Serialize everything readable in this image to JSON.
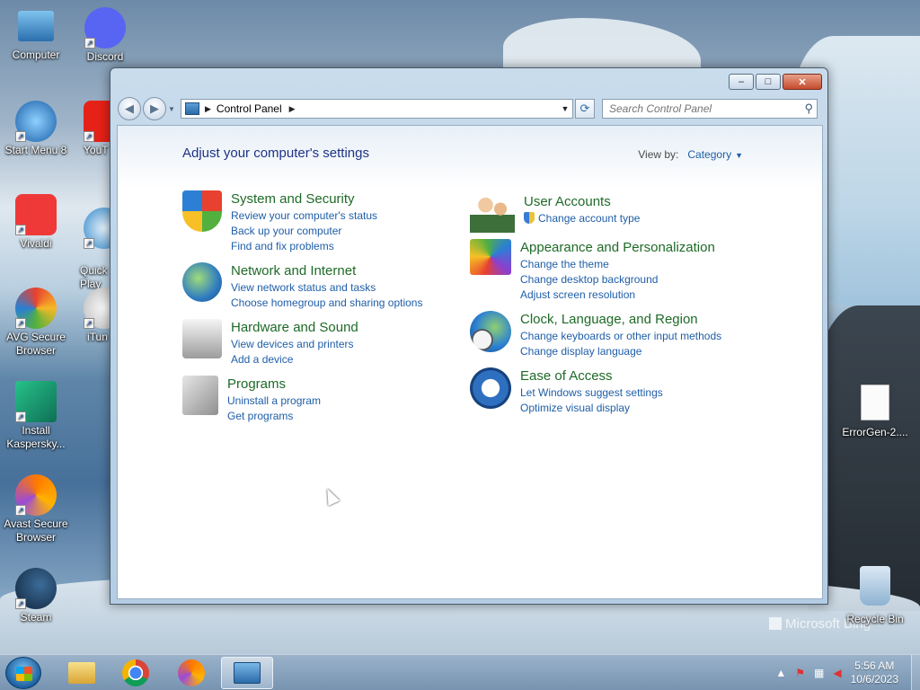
{
  "desktop": {
    "icons": [
      {
        "label": "Computer"
      },
      {
        "label": "Discord"
      },
      {
        "label": "Start Menu 8"
      },
      {
        "label": "YouT"
      },
      {
        "label": "Vivaldi"
      },
      {
        "label": "Quick\nPlay"
      },
      {
        "label": "AVG Secure Browser"
      },
      {
        "label": "iTun"
      },
      {
        "label": "Install Kaspersky..."
      },
      {
        "label": "Avast Secure Browser"
      },
      {
        "label": "Steam"
      },
      {
        "label": "ErrorGen-2...."
      },
      {
        "label": "Recycle Bin"
      }
    ],
    "watermark": "Microsoft Bing"
  },
  "window": {
    "title_buttons": {
      "minimize": "–",
      "maximize": "□",
      "close": "✕"
    },
    "nav": {
      "back": "◀",
      "forward": "▶",
      "dropdown": "▼"
    },
    "address": {
      "crumbs": [
        "Control Panel"
      ],
      "separator": "▶",
      "dropdown": "▼"
    },
    "refresh": "⟳",
    "search": {
      "placeholder": "Search Control Panel",
      "icon": "search-icon"
    },
    "heading": "Adjust your computer's settings",
    "view_by": {
      "label": "View by:",
      "value": "Category"
    },
    "categories_left": [
      {
        "title": "System and Security",
        "links": [
          "Review your computer's status",
          "Back up your computer",
          "Find and fix problems"
        ]
      },
      {
        "title": "Network and Internet",
        "links": [
          "View network status and tasks",
          "Choose homegroup and sharing options"
        ]
      },
      {
        "title": "Hardware and Sound",
        "links": [
          "View devices and printers",
          "Add a device"
        ]
      },
      {
        "title": "Programs",
        "links": [
          "Uninstall a program",
          "Get programs"
        ]
      }
    ],
    "categories_right": [
      {
        "title": "User Accounts",
        "links": [
          "Change account type"
        ]
      },
      {
        "title": "Appearance and Personalization",
        "links": [
          "Change the theme",
          "Change desktop background",
          "Adjust screen resolution"
        ]
      },
      {
        "title": "Clock, Language, and Region",
        "links": [
          "Change keyboards or other input methods",
          "Change display language"
        ]
      },
      {
        "title": "Ease of Access",
        "links": [
          "Let Windows suggest settings",
          "Optimize visual display"
        ]
      }
    ]
  },
  "taskbar": {
    "time": "5:56 AM",
    "date": "10/6/2023",
    "tray_arrow": "▲"
  },
  "colors": {
    "link": "#1f5ea8",
    "category_title": "#1e6a27",
    "heading": "#1e3287"
  }
}
